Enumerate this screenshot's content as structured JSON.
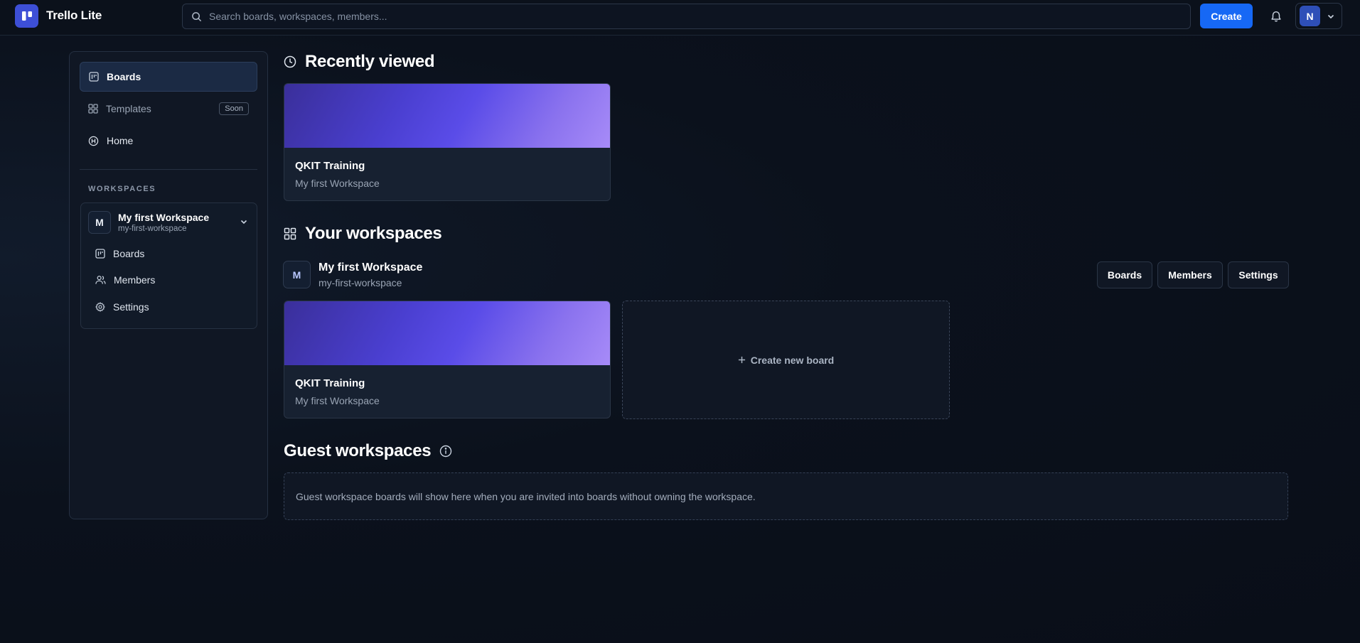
{
  "header": {
    "app_title": "Trello Lite",
    "search_placeholder": "Search boards, workspaces, members...",
    "create_label": "Create",
    "avatar_initial": "N",
    "icons": [
      "logo-icon",
      "search-icon",
      "bell-icon",
      "chevron-down-icon"
    ]
  },
  "sidebar": {
    "items": [
      {
        "label": "Boards",
        "icon": "board-icon",
        "active": true
      },
      {
        "label": "Templates",
        "icon": "grid-icon",
        "badge": "Soon"
      },
      {
        "label": "Home",
        "icon": "home-icon"
      }
    ],
    "workspaces_heading": "WORKSPACES",
    "workspace": {
      "initial": "M",
      "name": "My first Workspace",
      "slug": "my-first-workspace",
      "links": [
        {
          "label": "Boards",
          "icon": "board-icon"
        },
        {
          "label": "Members",
          "icon": "users-icon"
        },
        {
          "label": "Settings",
          "icon": "gear-icon"
        }
      ]
    }
  },
  "main": {
    "recently_viewed": {
      "title": "Recently viewed",
      "boards": [
        {
          "name": "QKIT Training",
          "workspace": "My first Workspace"
        }
      ]
    },
    "your_workspaces": {
      "title": "Your workspaces",
      "workspace": {
        "initial": "M",
        "name": "My first Workspace",
        "slug": "my-first-workspace",
        "actions": [
          "Boards",
          "Members",
          "Settings"
        ],
        "boards": [
          {
            "name": "QKIT Training",
            "workspace": "My first Workspace"
          }
        ],
        "create_board_label": "Create new board"
      }
    },
    "guest_workspaces": {
      "title": "Guest workspaces",
      "empty_text": "Guest workspace boards will show here when you are invited into boards without owning the workspace."
    }
  },
  "colors": {
    "accent": "#1668f5",
    "background": "#0b111c",
    "panel": "#101724",
    "cover_start": "#3a2f9a",
    "cover_end": "#a78bf8"
  }
}
